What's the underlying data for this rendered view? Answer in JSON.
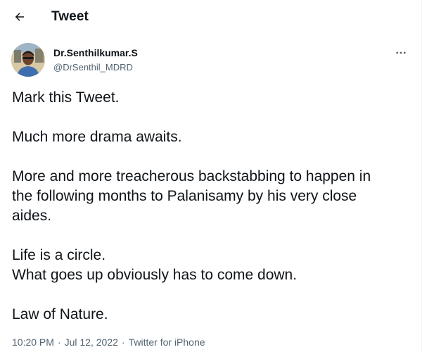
{
  "header": {
    "title": "Tweet"
  },
  "author": {
    "display_name": "Dr.Senthilkumar.S",
    "handle": "@DrSenthil_MDRD"
  },
  "tweet": {
    "lines": [
      "Mark this Tweet.",
      "",
      "Much more drama awaits.",
      "",
      "More and more treacherous backstabbing to happen in",
      "the following months to Palanisamy by his very close",
      "aides.",
      "",
      "Life is a circle.",
      "What goes up obviously has to come down.",
      "",
      "Law of Nature."
    ]
  },
  "meta": {
    "time": "10:20 PM",
    "separator": "·",
    "date": "Jul 12, 2022",
    "source": "Twitter for iPhone"
  },
  "icons": {
    "back": "arrow-left-icon",
    "more": "more-horizontal-icon"
  }
}
